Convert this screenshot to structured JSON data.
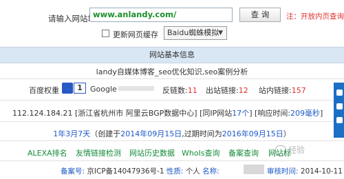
{
  "form": {
    "url_label": "请输入网站地址：",
    "url_value": "www.anlandy.com/",
    "query_button": "查 询",
    "note": "注：开放内页查询",
    "cache_label": "更新网页缓存",
    "ua_select": "Baidu蜘蛛模拟"
  },
  "section": {
    "title": "网站基本信息"
  },
  "site": {
    "title": "landy自媒体博客_seo优化知识,seo案例分析"
  },
  "weights": {
    "baidu_label": "百度权重",
    "baidu_rank": "1",
    "google_label": "Google",
    "backlinks_label": "反链数:",
    "backlinks_value": "11",
    "outbound_label": "出站链接:",
    "outbound_value": "12",
    "internal_label": "站内链接:",
    "internal_value": "157"
  },
  "server": {
    "ip": "112.124.184.21",
    "location": "[浙江省杭州市 阿里云BGP数据中心]",
    "same_ip_prefix": "[同IP网站",
    "same_ip_value": "17个",
    "same_ip_suffix": "]",
    "response_prefix": "[响应时间:",
    "response_value": "209毫秒",
    "response_suffix": "]"
  },
  "age": {
    "duration": "1年3月7天",
    "created_prefix": "（创建于",
    "created_date": "2014年09月15日",
    "expires_prefix": ",过期时间为",
    "expires_date": "2016年09月15日",
    "suffix": "）"
  },
  "links": {
    "items": [
      "ALEXA排名",
      "友情链接检测",
      "网站历史数据",
      "WhoIs查询",
      "备案查询",
      "网站标"
    ]
  },
  "beian": {
    "icp_label": "备案号:",
    "icp_value": "京ICP备14047936号-1",
    "nature_label": "性质:",
    "nature_value": "个人",
    "name_label": "名称:",
    "audit_label": "审核时间:",
    "audit_value": "2014-10-11"
  },
  "watermark": {
    "text": "经验"
  },
  "colors": {
    "red": "#e0302c",
    "blue": "#1d58c7",
    "green": "#148a3a",
    "header_bg": "#d9e6f4"
  }
}
